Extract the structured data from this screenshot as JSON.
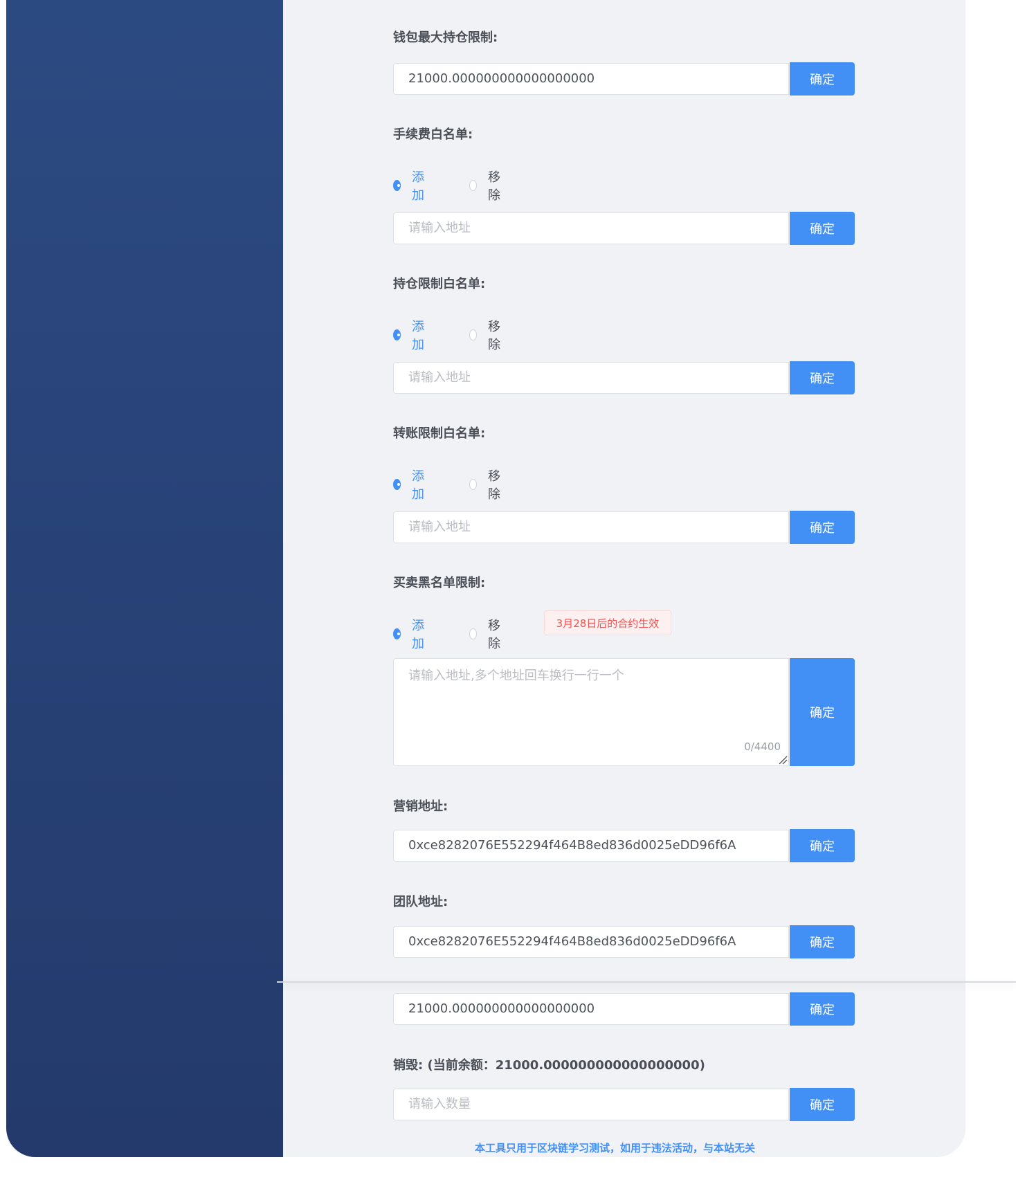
{
  "wallet_limit": {
    "label": "钱包最大持仓限制:",
    "value": "21000.000000000000000000",
    "button": "确定"
  },
  "fee_whitelist": {
    "label": "手续费白名单:",
    "options": [
      "添加",
      "移除"
    ],
    "selected": "添加",
    "placeholder": "请输入地址",
    "button": "确定"
  },
  "holding_whitelist": {
    "label": "持仓限制白名单:",
    "options": [
      "添加",
      "移除"
    ],
    "selected": "添加",
    "placeholder": "请输入地址",
    "button": "确定"
  },
  "transfer_whitelist": {
    "label": "转账限制白名单:",
    "options": [
      "添加",
      "移除"
    ],
    "selected": "添加",
    "placeholder": "请输入地址",
    "button": "确定"
  },
  "blacklist": {
    "label": "买卖黑名单限制:",
    "options": [
      "添加",
      "移除"
    ],
    "selected": "添加",
    "notice": "3月28日后的合约生效",
    "placeholder": "请输入地址,多个地址回车换行一行一个",
    "counter": "0/4400",
    "button": "确定"
  },
  "marketing_address": {
    "label": "营销地址:",
    "value": "0xce8282076E552294f464B8ed836d0025eDD96f6A",
    "button": "确定"
  },
  "team_address": {
    "label": "团队地址:",
    "value": "0xce8282076E552294f464B8ed836d0025eDD96f6A",
    "button": "确定"
  },
  "amount_row": {
    "value": "21000.000000000000000000",
    "button": "确定"
  },
  "burn": {
    "label": "销毁: (当前余额：21000.000000000000000000)",
    "placeholder": "请输入数量",
    "button": "确定"
  },
  "footer": "本工具只用于区块链学习测试，如用于违法活动，与本站无关",
  "colors": {
    "sidebar": "#2c4a82",
    "accent": "#4290f5",
    "background": "#f0f2f5",
    "notice_text": "#ef5350"
  }
}
